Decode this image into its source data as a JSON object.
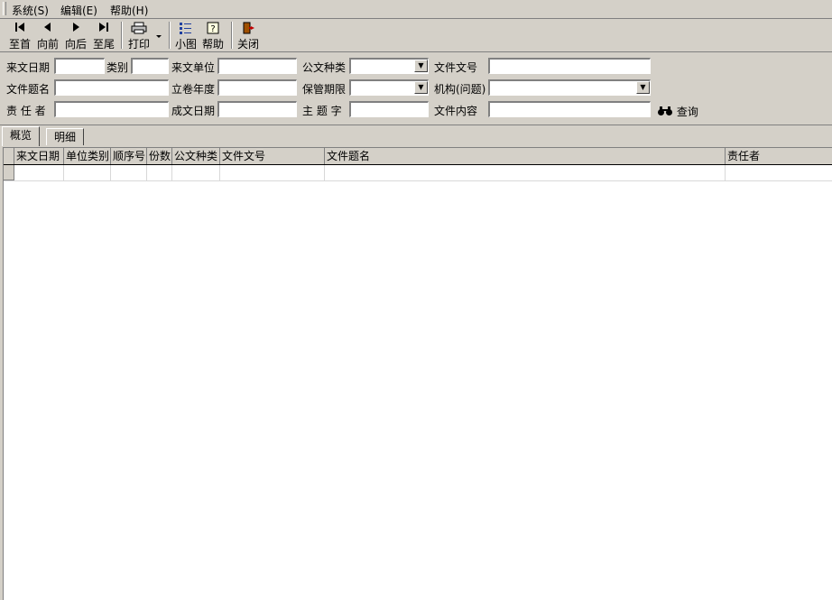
{
  "menubar": {
    "items": [
      "系统(S)",
      "编辑(E)",
      "帮助(H)"
    ]
  },
  "toolbar": {
    "first_label": "至首",
    "prev_label": "向前",
    "next_label": "向后",
    "last_label": "至尾",
    "print_label": "打印",
    "small_icon_label": "小图",
    "help_label": "帮助",
    "close_label": "关闭"
  },
  "filters": {
    "arrival_date_label": "来文日期",
    "category_label": "类别",
    "sender_unit_label": "来文单位",
    "doc_type_label": "公文种类",
    "doc_number_label": "文件文号",
    "doc_title_label": "文件题名",
    "filing_year_label": "立卷年度",
    "retention_label": "保管期限",
    "org_label": "机构(问题)",
    "responsible_label": "责 任 者",
    "created_date_label": "成文日期",
    "subject_label": "主 题 字",
    "content_label": "文件内容",
    "search_label": "查询",
    "values": {
      "arrival_date": "",
      "category": "",
      "sender_unit": "",
      "doc_type": "",
      "doc_number": "",
      "doc_title": "",
      "filing_year": "",
      "retention": "",
      "org": "",
      "responsible": "",
      "created_date": "",
      "subject": "",
      "content": ""
    }
  },
  "tabs": [
    "概览",
    "明细"
  ],
  "grid": {
    "columns": [
      "来文日期",
      "单位类别",
      "顺序号",
      "份数",
      "公文种类",
      "文件文号",
      "文件题名",
      "责任者"
    ]
  }
}
